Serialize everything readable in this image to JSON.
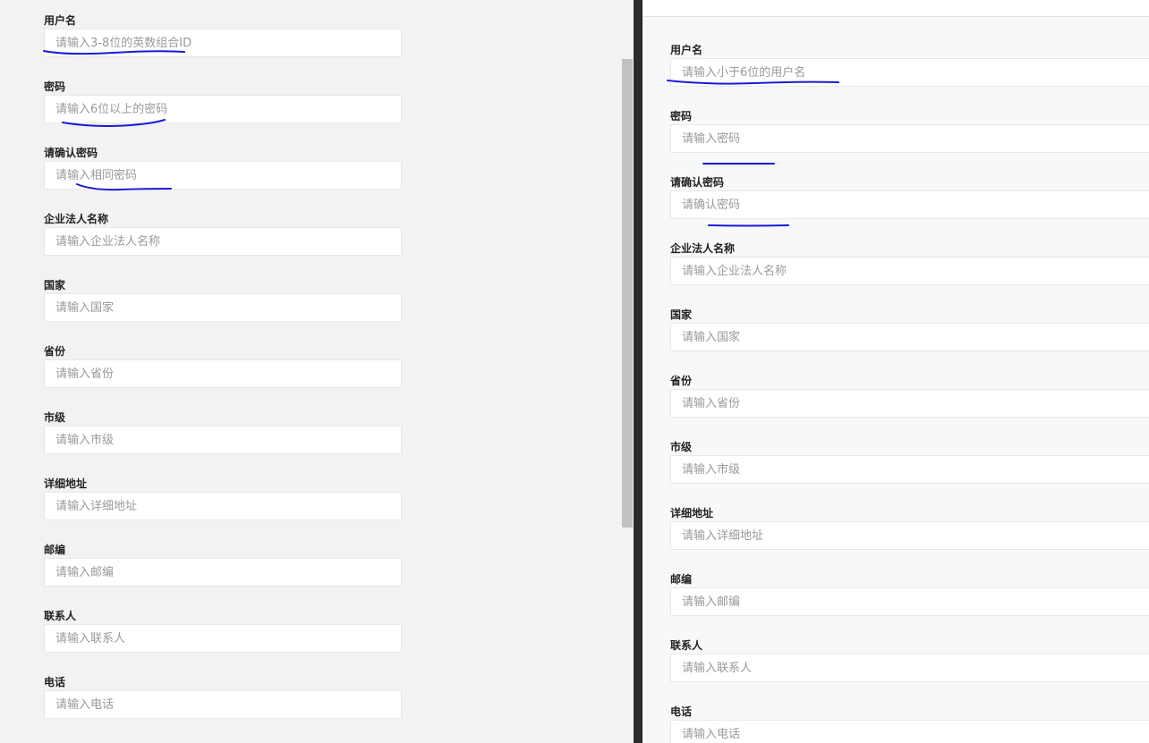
{
  "left_form": {
    "fields": [
      {
        "label": "用户名",
        "placeholder": "请输入3-8位的英数组合ID"
      },
      {
        "label": "密码",
        "placeholder": "请输入6位以上的密码"
      },
      {
        "label": "请确认密码",
        "placeholder": "请输入相同密码"
      },
      {
        "label": "企业法人名称",
        "placeholder": "请输入企业法人名称"
      },
      {
        "label": "国家",
        "placeholder": "请输入国家"
      },
      {
        "label": "省份",
        "placeholder": "请输入省份"
      },
      {
        "label": "市级",
        "placeholder": "请输入市级"
      },
      {
        "label": "详细地址",
        "placeholder": "请输入详细地址"
      },
      {
        "label": "邮编",
        "placeholder": "请输入邮编"
      },
      {
        "label": "联系人",
        "placeholder": "请输入联系人"
      },
      {
        "label": "电话",
        "placeholder": "请输入电话"
      }
    ]
  },
  "right_form": {
    "fields": [
      {
        "label": "用户名",
        "placeholder": "请输入小于6位的用户名"
      },
      {
        "label": "密码",
        "placeholder": "请输入密码"
      },
      {
        "label": "请确认密码",
        "placeholder": "请确认密码"
      },
      {
        "label": "企业法人名称",
        "placeholder": "请输入企业法人名称"
      },
      {
        "label": "国家",
        "placeholder": "请输入国家"
      },
      {
        "label": "省份",
        "placeholder": "请输入省份"
      },
      {
        "label": "市级",
        "placeholder": "请输入市级"
      },
      {
        "label": "详细地址",
        "placeholder": "请输入详细地址"
      },
      {
        "label": "邮编",
        "placeholder": "请输入邮编"
      },
      {
        "label": "联系人",
        "placeholder": "请输入联系人"
      },
      {
        "label": "电话",
        "placeholder": "请输入电话"
      }
    ]
  },
  "colors": {
    "annotation": "#1a1ad6",
    "left_background": "#f2f2f2",
    "right_background": "#f7f8fa",
    "divider": "#2b2b2b"
  }
}
